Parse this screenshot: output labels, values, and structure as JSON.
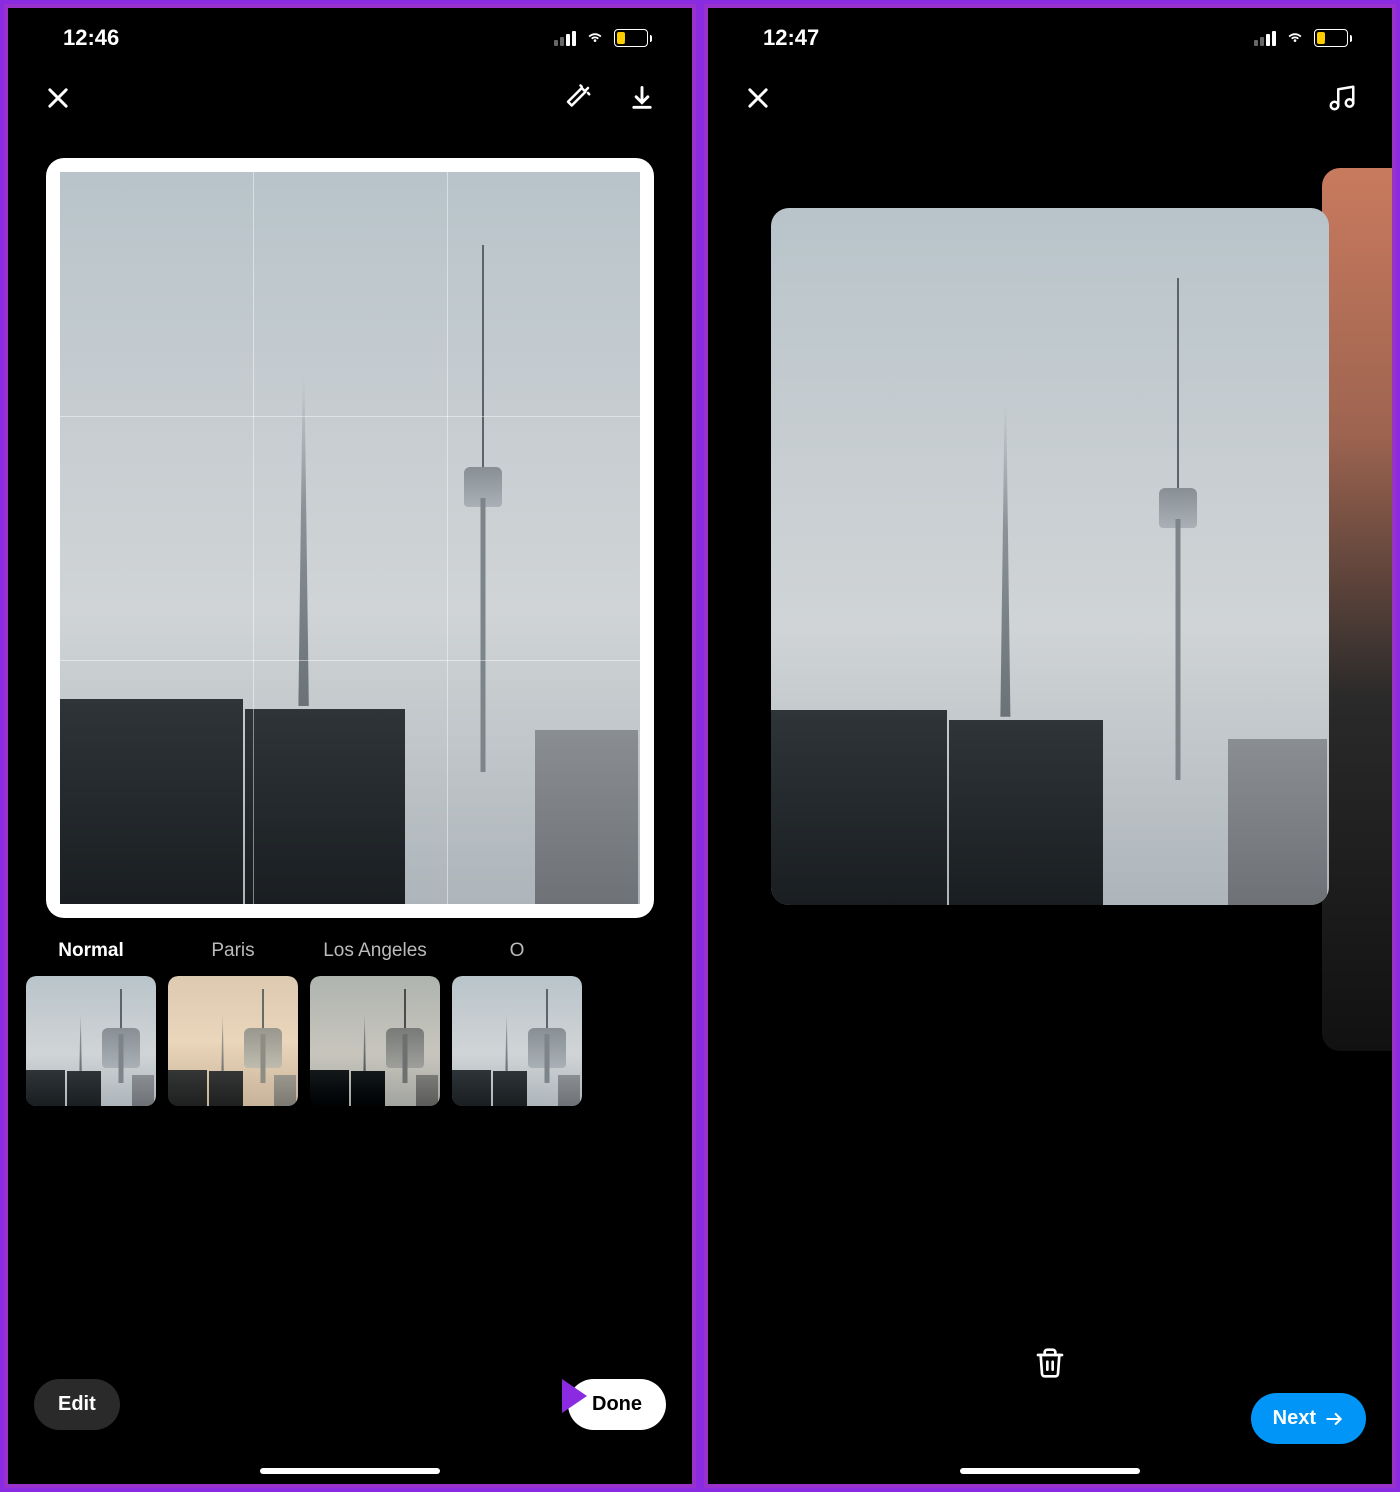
{
  "left": {
    "status": {
      "time": "12:46",
      "battery": "22"
    },
    "filters": [
      {
        "label": "Normal",
        "active": true,
        "variant": "normal"
      },
      {
        "label": "Paris",
        "active": false,
        "variant": "warm"
      },
      {
        "label": "Los Angeles",
        "active": false,
        "variant": "la"
      },
      {
        "label": "O",
        "active": false,
        "variant": "normal"
      }
    ],
    "actions": {
      "edit": "Edit",
      "done": "Done"
    }
  },
  "right": {
    "status": {
      "time": "12:47",
      "battery": "22"
    },
    "actions": {
      "next": "Next"
    }
  },
  "colors": {
    "accent_blue": "#0095f6",
    "annotation_purple": "#9932cc",
    "battery_yellow": "#ffcc00"
  }
}
